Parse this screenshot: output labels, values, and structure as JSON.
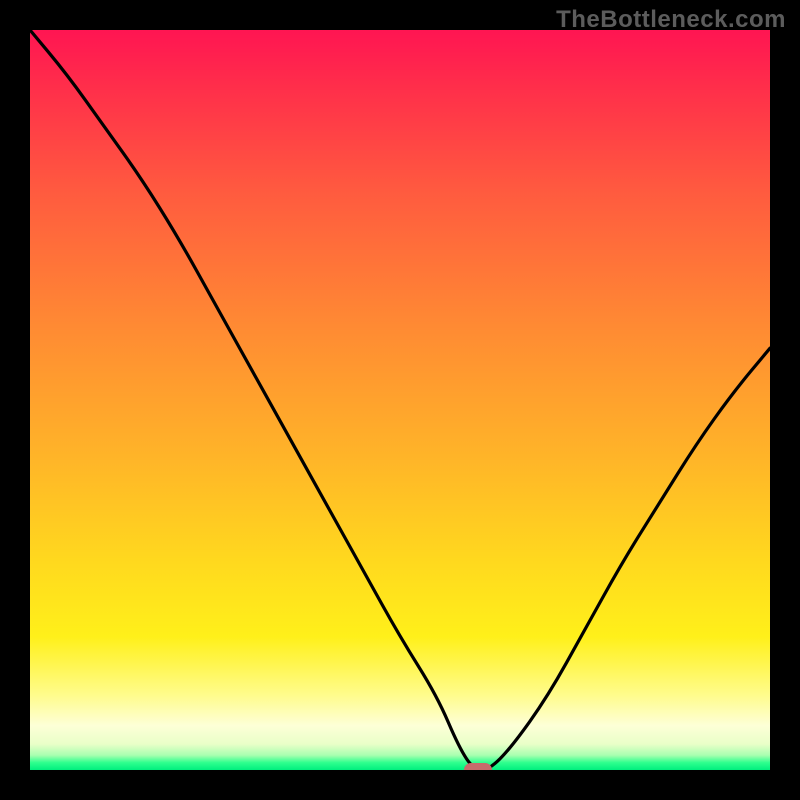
{
  "watermark": "TheBottleneck.com",
  "colors": {
    "black": "#000000",
    "curve": "#000000",
    "marker": "#c76b6b",
    "watermark": "#5c5c5c"
  },
  "chart_data": {
    "type": "line",
    "title": "",
    "xlabel": "",
    "ylabel": "",
    "xlim": [
      0,
      100
    ],
    "ylim": [
      0,
      100
    ],
    "grid": false,
    "series": [
      {
        "name": "bottleneck-curve",
        "x": [
          0,
          5,
          10,
          15,
          20,
          25,
          30,
          35,
          40,
          45,
          50,
          55,
          58,
          60,
          62,
          65,
          70,
          75,
          80,
          85,
          90,
          95,
          100
        ],
        "y": [
          100,
          94,
          87,
          80,
          72,
          63,
          54,
          45,
          36,
          27,
          18,
          10,
          3,
          0,
          0,
          3,
          10,
          19,
          28,
          36,
          44,
          51,
          57
        ]
      }
    ],
    "marker": {
      "x": 60.5,
      "y": 0
    },
    "background_gradient": [
      {
        "stop": 0.0,
        "color": "#ff1552"
      },
      {
        "stop": 0.22,
        "color": "#ff5b3f"
      },
      {
        "stop": 0.58,
        "color": "#ffb528"
      },
      {
        "stop": 0.82,
        "color": "#fff01a"
      },
      {
        "stop": 0.94,
        "color": "#fdffd7"
      },
      {
        "stop": 0.99,
        "color": "#2fff8e"
      },
      {
        "stop": 1.0,
        "color": "#00ef7e"
      }
    ]
  }
}
